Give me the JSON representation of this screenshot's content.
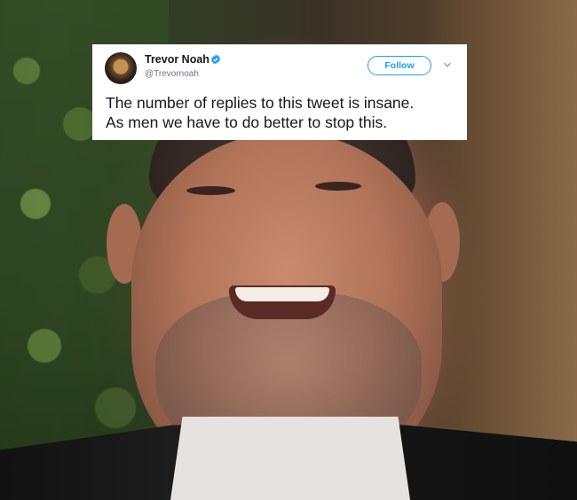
{
  "tweet": {
    "display_name": "Trevor Noah",
    "handle": "@Trevornoah",
    "follow_label": "Follow",
    "text_lines": [
      "The number of replies to this tweet is insane.",
      "As men we have to do better to stop this."
    ],
    "verified_icon": "verified-badge-icon",
    "menu_icon": "chevron-down-icon"
  },
  "colors": {
    "accent": "#1da1f2",
    "text": "#14171a",
    "muted": "#657786"
  }
}
